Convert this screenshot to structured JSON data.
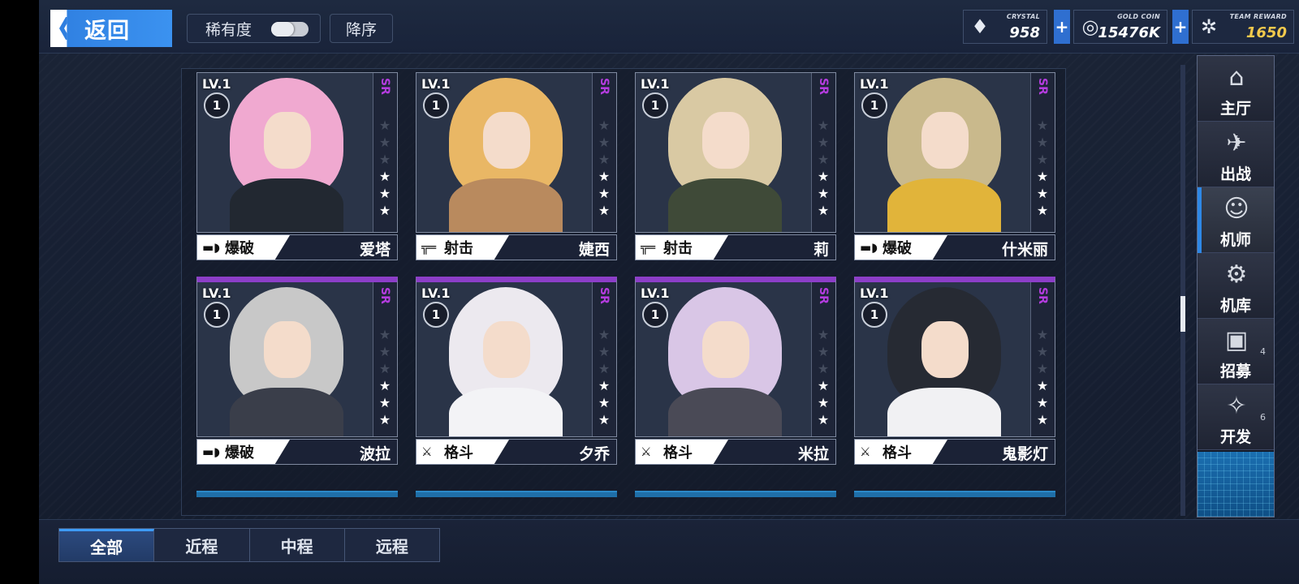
{
  "header": {
    "back_label": "返回",
    "rarity_label": "稀有度",
    "sort_label": "降序"
  },
  "currencies": {
    "crystal": {
      "caption": "CRYSTAL",
      "value": "958",
      "icon": "crystal-icon"
    },
    "gold": {
      "caption": "GOLD COIN",
      "value": "15476K",
      "icon": "gold-coin-icon"
    },
    "reward": {
      "caption": "TEAM REWARD",
      "value": "1650",
      "icon": "team-reward-icon"
    },
    "plus": "+"
  },
  "cards": [
    {
      "level": "LV.1",
      "rank": "1",
      "rarity": "SR",
      "class": "爆破",
      "weapon_icon": "cannon-icon",
      "name": "爱塔",
      "stars_total": 6,
      "stars_filled": 3,
      "hair": "#f0a9d0",
      "body": "#222831"
    },
    {
      "level": "LV.1",
      "rank": "1",
      "rarity": "SR",
      "class": "射击",
      "weapon_icon": "rifle-icon",
      "name": "婕西",
      "stars_total": 6,
      "stars_filled": 3,
      "hair": "#e9b765",
      "body": "#b98a5e"
    },
    {
      "level": "LV.1",
      "rank": "1",
      "rarity": "SR",
      "class": "射击",
      "weapon_icon": "rifle-icon",
      "name": "莉",
      "stars_total": 6,
      "stars_filled": 3,
      "hair": "#d9c9a3",
      "body": "#3f4a38"
    },
    {
      "level": "LV.1",
      "rank": "1",
      "rarity": "SR",
      "class": "爆破",
      "weapon_icon": "cannon-icon",
      "name": "什米丽",
      "stars_total": 6,
      "stars_filled": 3,
      "hair": "#c9b98c",
      "body": "#e1b43a"
    },
    {
      "level": "LV.1",
      "rank": "1",
      "rarity": "SR",
      "class": "爆破",
      "weapon_icon": "cannon-icon",
      "name": "波拉",
      "stars_total": 6,
      "stars_filled": 3,
      "hair": "#c8c8c8",
      "body": "#3a3e4a"
    },
    {
      "level": "LV.1",
      "rank": "1",
      "rarity": "SR",
      "class": "格斗",
      "weapon_icon": "crossed-swords-icon",
      "name": "夕乔",
      "stars_total": 6,
      "stars_filled": 3,
      "hair": "#ece9ef",
      "body": "#f3f3f6"
    },
    {
      "level": "LV.1",
      "rank": "1",
      "rarity": "SR",
      "class": "格斗",
      "weapon_icon": "crossed-swords-icon",
      "name": "米拉",
      "stars_total": 6,
      "stars_filled": 3,
      "hair": "#d9c6e6",
      "body": "#4a4a56"
    },
    {
      "level": "LV.1",
      "rank": "1",
      "rarity": "SR",
      "class": "格斗",
      "weapon_icon": "crossed-swords-icon",
      "name": "鬼影灯",
      "stars_total": 6,
      "stars_filled": 3,
      "hair": "#262a33",
      "body": "#f1f1f3"
    }
  ],
  "side_nav": [
    {
      "label": "主厅",
      "icon": "main-hall-icon",
      "badge": ""
    },
    {
      "label": "出战",
      "icon": "battle-icon",
      "badge": ""
    },
    {
      "label": "机师",
      "icon": "pilot-icon",
      "badge": "",
      "active": true
    },
    {
      "label": "机库",
      "icon": "hangar-icon",
      "badge": ""
    },
    {
      "label": "招募",
      "icon": "recruit-icon",
      "badge": "4"
    },
    {
      "label": "开发",
      "icon": "develop-icon",
      "badge": "6"
    }
  ],
  "tabs": [
    {
      "label": "全部",
      "active": true
    },
    {
      "label": "近程"
    },
    {
      "label": "中程"
    },
    {
      "label": "远程"
    }
  ]
}
